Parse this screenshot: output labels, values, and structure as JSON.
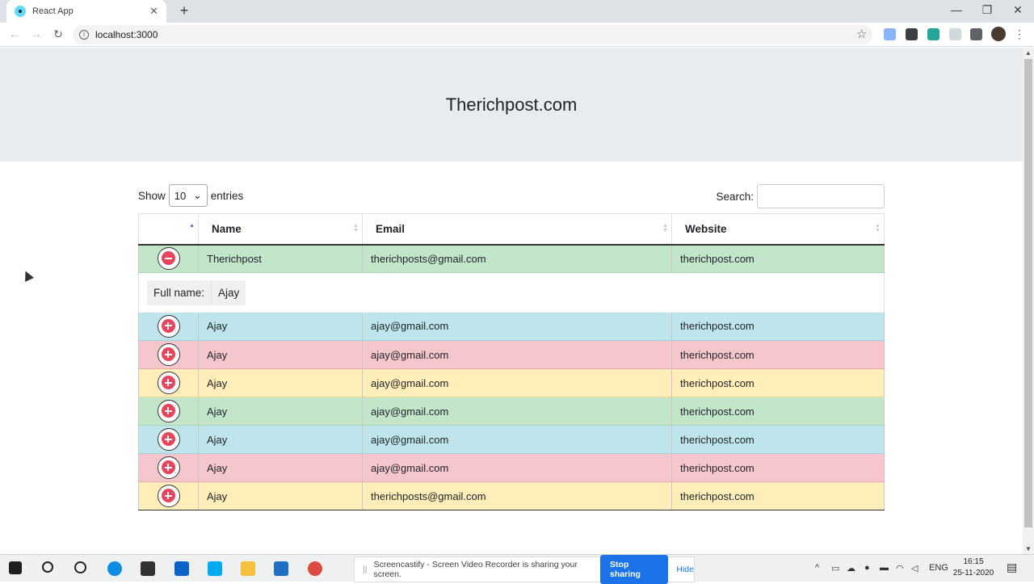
{
  "browser": {
    "tab_title": "React App",
    "tab_close": "✕",
    "new_tab": "+",
    "url": "localhost:3000",
    "back": "←",
    "forward": "→",
    "reload": "↻",
    "star": "☆",
    "menu": "⋮",
    "minimize": "—",
    "maximize": "❐",
    "close": "✕"
  },
  "page": {
    "title": "Therichpost.com"
  },
  "controls": {
    "show_label": "Show",
    "entries_value": "10",
    "entries_label": "entries",
    "search_label": "Search:"
  },
  "table": {
    "columns": [
      "",
      "Name",
      "Email",
      "Website"
    ],
    "rows": [
      {
        "name": "Therichpost",
        "email": "therichposts@gmail.com",
        "website": "therichpost.com",
        "color": "green",
        "expanded": true
      },
      {
        "name": "Ajay",
        "email": "ajay@gmail.com",
        "website": "therichpost.com",
        "color": "blue"
      },
      {
        "name": "Ajay",
        "email": "ajay@gmail.com",
        "website": "therichpost.com",
        "color": "red"
      },
      {
        "name": "Ajay",
        "email": "ajay@gmail.com",
        "website": "therichpost.com",
        "color": "yellow"
      },
      {
        "name": "Ajay",
        "email": "ajay@gmail.com",
        "website": "therichpost.com",
        "color": "green"
      },
      {
        "name": "Ajay",
        "email": "ajay@gmail.com",
        "website": "therichpost.com",
        "color": "blue"
      },
      {
        "name": "Ajay",
        "email": "ajay@gmail.com",
        "website": "therichpost.com",
        "color": "red"
      },
      {
        "name": "Ajay",
        "email": "therichposts@gmail.com",
        "website": "therichpost.com",
        "color": "yellow"
      }
    ],
    "child": {
      "label": "Full name:",
      "value": "Ajay"
    }
  },
  "sharing_bar": {
    "message": "Screencastify - Screen Video Recorder is sharing your screen.",
    "stop_label": "Stop sharing",
    "hide_label": "Hide"
  },
  "tray": {
    "language": "ENG",
    "time": "16:15",
    "date": "25-11-2020"
  },
  "colors": {
    "success": "#c3e6cb",
    "info": "#bee5eb",
    "danger": "#f5c6cb",
    "warning": "#ffeeba",
    "button_red": "#e8455c"
  }
}
